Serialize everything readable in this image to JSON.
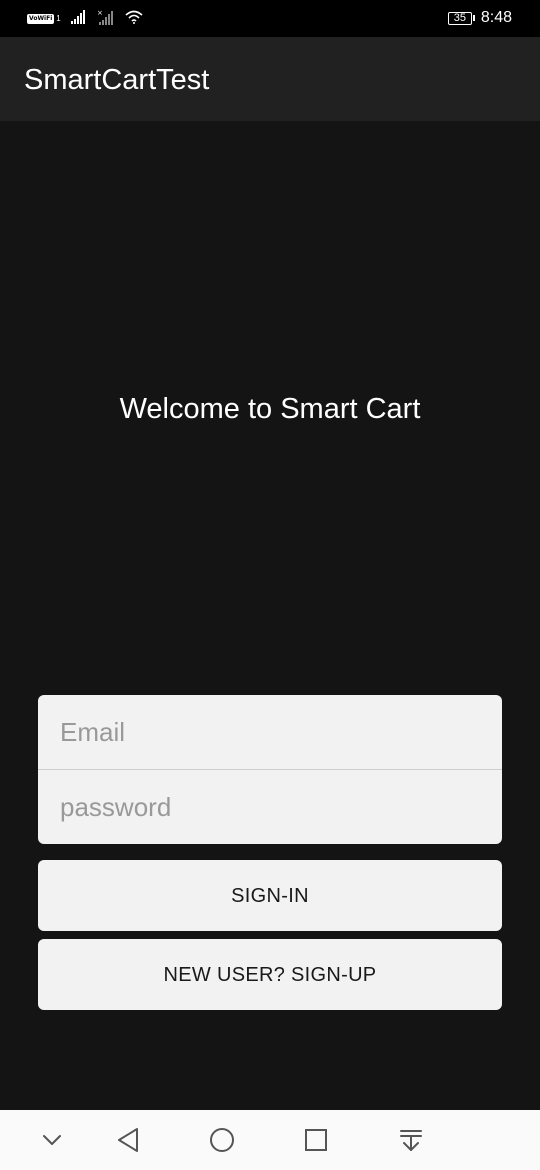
{
  "status_bar": {
    "wifi_badge": "VoWiFi",
    "wifi_badge_sub": "1",
    "battery_level": "35",
    "time": "8:48"
  },
  "app_bar": {
    "title": "SmartCartTest"
  },
  "main": {
    "welcome_text": "Welcome to Smart Cart",
    "email_placeholder": "Email",
    "email_value": "",
    "password_placeholder": "password",
    "password_value": "",
    "signin_label": "SIGN-IN",
    "signup_label": "NEW USER? SIGN-UP"
  },
  "nav_bar": {
    "icons": [
      "chevron-down-icon",
      "back-triangle-icon",
      "home-circle-icon",
      "recents-square-icon",
      "notification-pull-icon"
    ]
  },
  "colors": {
    "background": "#141414",
    "app_bar": "#212121",
    "status_bar": "#000000",
    "field_bg": "#f2f2f2",
    "nav_bar": "#fafafa"
  }
}
